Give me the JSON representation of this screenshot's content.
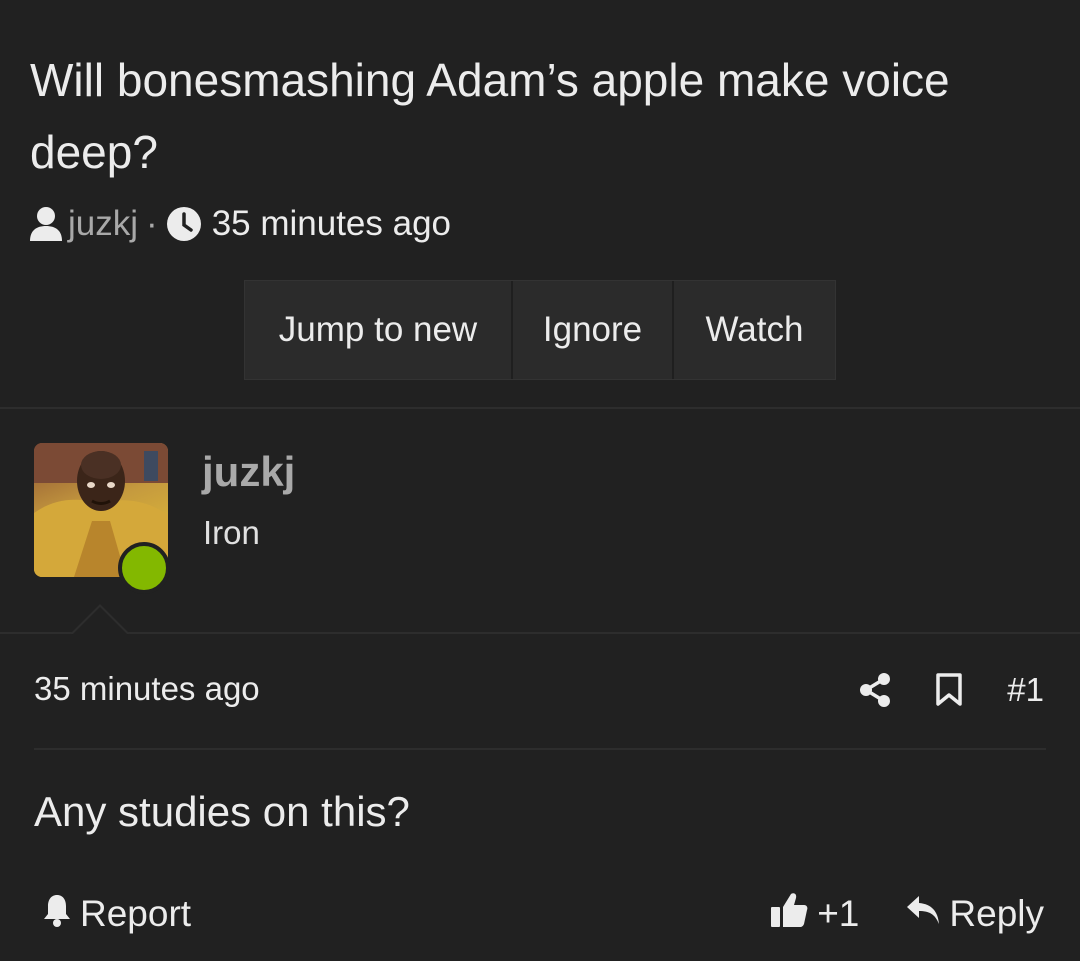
{
  "thread": {
    "title": "Will bonesmashing Adam’s apple make voice deep?",
    "author": "juzkj",
    "separator": "·",
    "time": "35 minutes ago"
  },
  "thread_actions": {
    "jump": "Jump to new",
    "ignore": "Ignore",
    "watch": "Watch"
  },
  "post": {
    "username": "juzkj",
    "user_title": "Iron",
    "online_color": "#83b800",
    "time": "35 minutes ago",
    "number": "#1",
    "body": "Any studies on this?",
    "report_label": "Report",
    "reaction_label": "+1",
    "reply_label": "Reply"
  },
  "icons": {
    "author": "user-icon",
    "time": "clock-icon",
    "share": "share-icon",
    "bookmark": "bookmark-icon",
    "report": "bell-icon",
    "like": "thumbs-up-icon",
    "reply": "reply-icon"
  }
}
